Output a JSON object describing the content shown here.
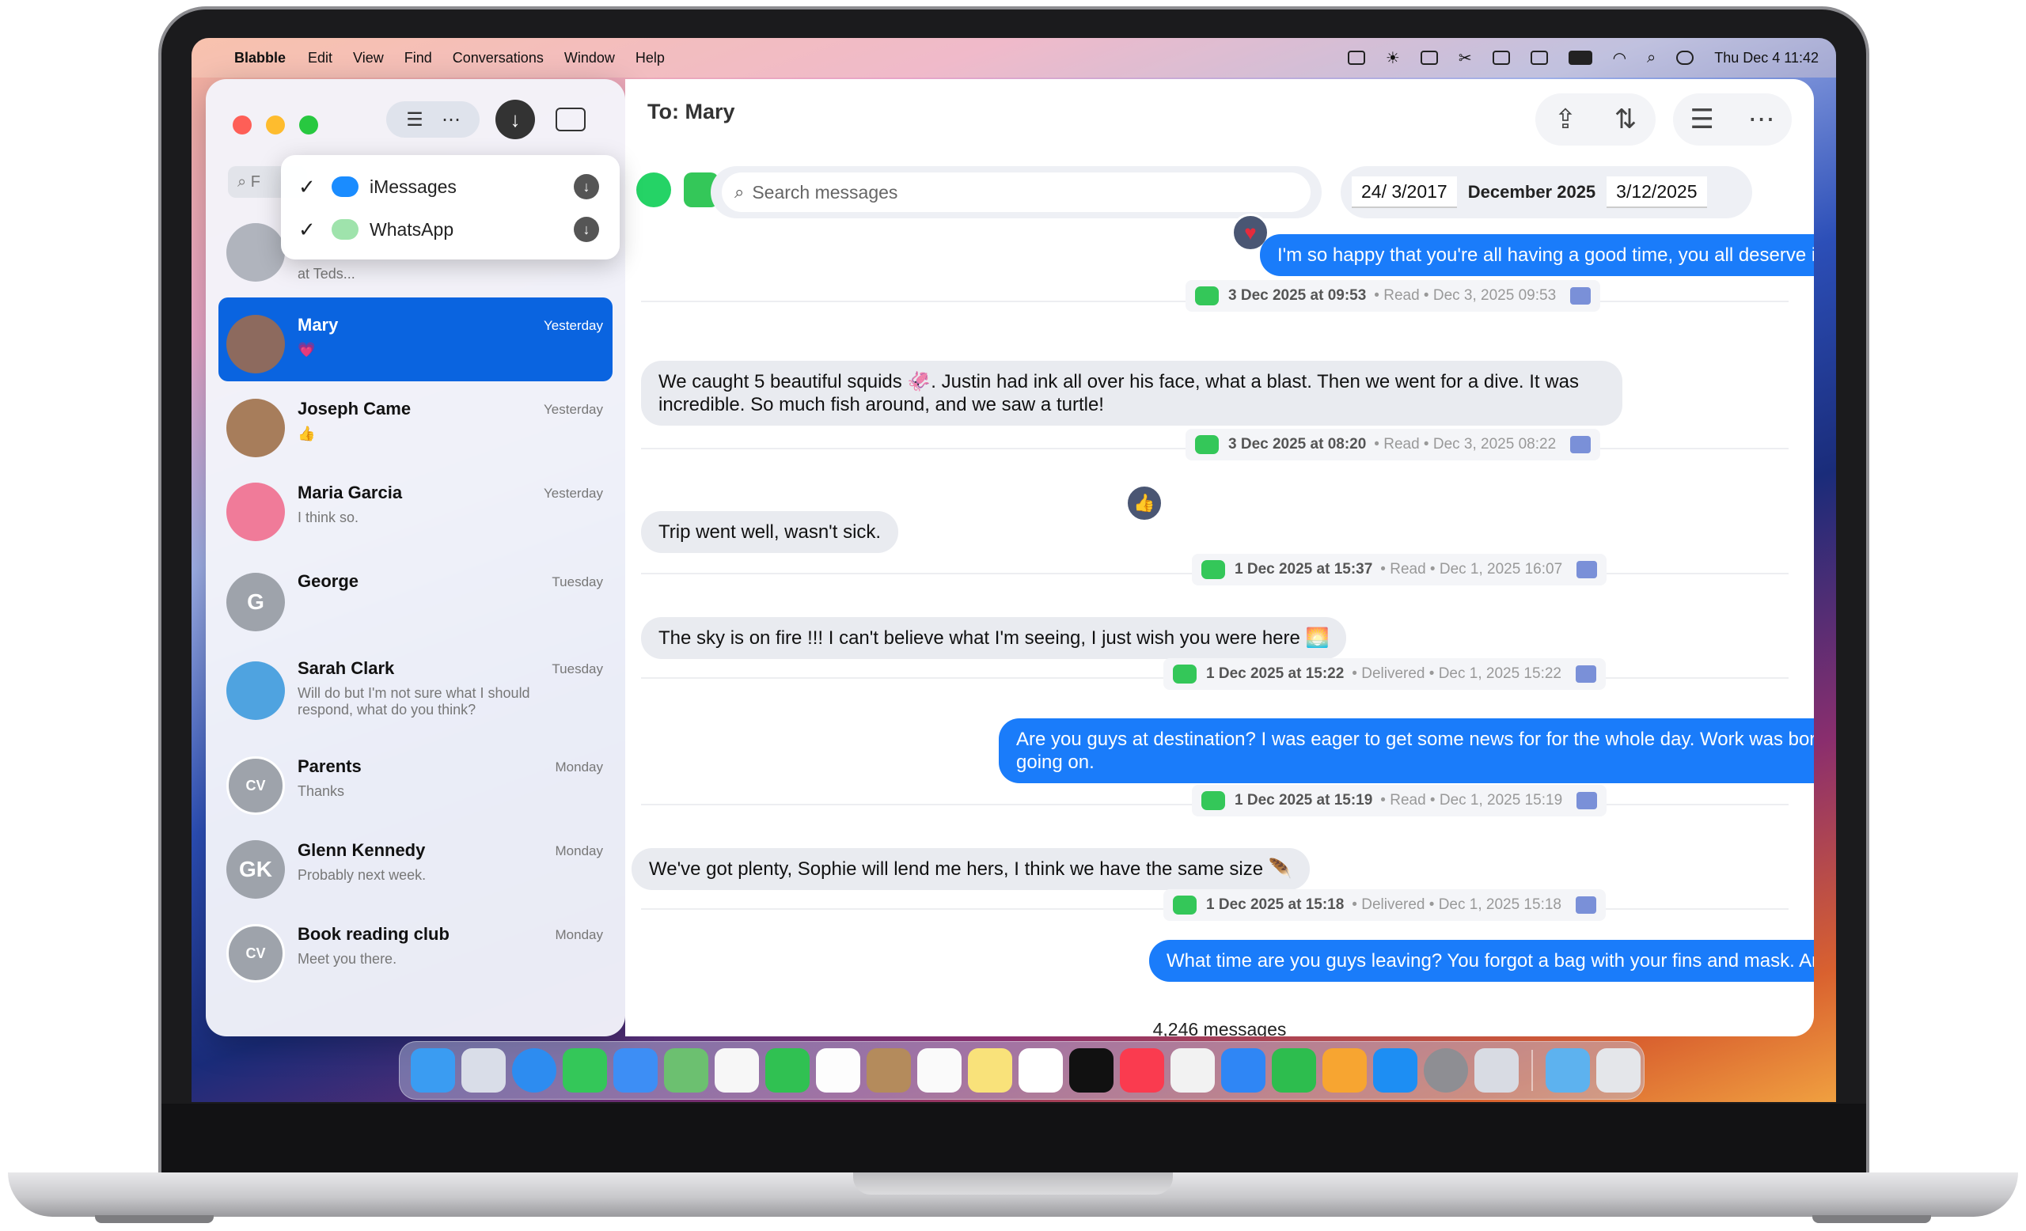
{
  "menubar": {
    "app_name": "Blabble",
    "items": [
      "Edit",
      "View",
      "Find",
      "Conversations",
      "Window",
      "Help"
    ],
    "clock": "Thu Dec 4  11:42"
  },
  "sidebar": {
    "search_placeholder": "F",
    "conversations": [
      {
        "name": "",
        "time": "",
        "preview": "at Teds...",
        "avatar_initials": "",
        "avatar_color": "#b0b4bd"
      },
      {
        "name": "Mary",
        "time": "Yesterday",
        "preview": "💗",
        "avatar_initials": "",
        "avatar_color": "#8d6a5e"
      },
      {
        "name": "Joseph Came",
        "time": "Yesterday",
        "preview": "👍",
        "avatar_initials": "",
        "avatar_color": "#a77d5b"
      },
      {
        "name": "Maria Garcia",
        "time": "Yesterday",
        "preview": "I think so.",
        "avatar_initials": "",
        "avatar_color": "#f07b99"
      },
      {
        "name": "George",
        "time": "Tuesday",
        "preview": "",
        "avatar_initials": "G",
        "avatar_color": "#9ea3ab"
      },
      {
        "name": "Sarah Clark",
        "time": "Tuesday",
        "preview": "Will do but I'm not sure what I should respond, what do you think?",
        "avatar_initials": "",
        "avatar_color": "#4fa3e0"
      },
      {
        "name": "Parents",
        "time": "Monday",
        "preview": "Thanks",
        "avatar_initials": "CV",
        "avatar_color": "#9ea3ab"
      },
      {
        "name": "Glenn Kennedy",
        "time": "Monday",
        "preview": "Probably next week.",
        "avatar_initials": "GK",
        "avatar_color": "#9ea3ab"
      },
      {
        "name": "Book reading club",
        "time": "Monday",
        "preview": "Meet you there.",
        "avatar_initials": "CV",
        "avatar_color": "#9ea3ab"
      }
    ]
  },
  "filter_dropdown": {
    "items": [
      {
        "label": "iMessages",
        "checked": "✓",
        "color": "#1a8cff"
      },
      {
        "label": "WhatsApp",
        "checked": "✓",
        "color": "#34c759"
      }
    ]
  },
  "main": {
    "title": "To: Mary",
    "search_placeholder": "Search messages",
    "date_from": "24/  3/2017",
    "date_month": "December 2025",
    "date_to": "3/12/2025",
    "message_count": "4,246 messages",
    "messages": [
      {
        "dir": "out",
        "text": "I'm so happy that you're all having a good time, you all deserve it !!! 🙌",
        "tapback": "♥"
      },
      {
        "meta_ts": "3 Dec 2025 at 09:53",
        "meta_status": "• Read • Dec 3, 2025  09:53"
      },
      {
        "dir": "in",
        "text": "We caught 5 beautiful squids 🦑. Justin had ink all over his face, what a blast. Then we went for a dive. It was incredible. So much fish around, and we saw a turtle!",
        "tapback": "♥"
      },
      {
        "meta_ts": "3 Dec 2025 at 08:20",
        "meta_status": "• Read • Dec 3, 2025  08:22"
      },
      {
        "dir": "in",
        "text": "Trip went well, wasn't sick.",
        "tapback": "👍"
      },
      {
        "meta_ts": "1 Dec 2025 at 15:37",
        "meta_status": "• Read • Dec 1, 2025  16:07"
      },
      {
        "dir": "in",
        "text": "The sky is on fire !!! I can't believe what I'm seeing, I just wish you were here 🌅"
      },
      {
        "meta_ts": "1 Dec 2025 at 15:22",
        "meta_status": "• Delivered • Dec 1, 2025  15:22"
      },
      {
        "dir": "out",
        "text": "Are you guys at destination? I was eager to get some news for for the whole day. Work was boring, not much going on."
      },
      {
        "meta_ts": "1 Dec 2025 at 15:19",
        "meta_status": "• Read • Dec 1, 2025  15:19"
      },
      {
        "dir": "in",
        "text": "We've got plenty, Sophie will lend me hers, I think we have the same size 🪶"
      },
      {
        "meta_ts": "1 Dec 2025 at 15:18",
        "meta_status": "• Delivered • Dec 1, 2025  15:18"
      },
      {
        "dir": "out",
        "text": "What time are you guys leaving? You forgot a bag with your fins and mask. Any spares"
      }
    ]
  }
}
